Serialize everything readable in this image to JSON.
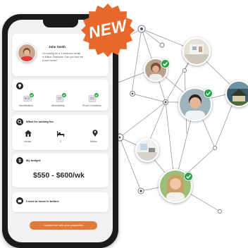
{
  "badge": {
    "text": "NEW",
    "color": "#e8682b"
  },
  "colors": {
    "accent": "#e07a3a",
    "verified": "#26a646",
    "phone": "#1b1b1d"
  },
  "app": {
    "profile": {
      "name": "John Smith",
      "message": [
        "I'm looking for a 3-bedroom house",
        "in Milton, Brisbane. Can you find me",
        "a new home?"
      ]
    },
    "verification": {
      "icon": "lightbulb-icon",
      "items": [
        {
          "label": "Identification",
          "icon": "id-card-icon"
        },
        {
          "label": "Affordability",
          "icon": "payslip-icon"
        },
        {
          "label": "Proof of Address",
          "icon": "address-doc-icon"
        }
      ]
    },
    "looking_for": {
      "title": "What I'm looking for:",
      "items": [
        {
          "label": "House",
          "icon": "house-icon"
        },
        {
          "label": "3",
          "icon": "bed-icon"
        },
        {
          "label": "Milton",
          "icon": "map-pin-icon"
        }
      ]
    },
    "budget": {
      "title": "My budget:",
      "value": "$550 - $600/wk"
    },
    "move_in": {
      "title": "I need to move in before:"
    },
    "cta": "Contact me with your properties"
  }
}
